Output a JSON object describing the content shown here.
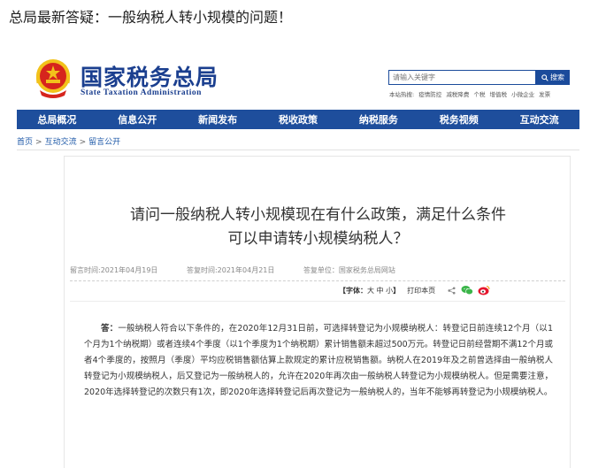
{
  "article": {
    "title": "总局最新答疑：一般纳税人转小规模的问题！"
  },
  "site": {
    "name_cn": "国家税务总局",
    "name_en": "State Taxation Administration"
  },
  "search": {
    "placeholder": "请输入关键字",
    "button_label": "搜索",
    "hot_label": "本站热搜:",
    "hot_terms": [
      "疫情防控",
      "减税降费",
      "个税",
      "增值税",
      "小微企业",
      "发票"
    ]
  },
  "nav": {
    "items": [
      "总局概况",
      "信息公开",
      "新闻发布",
      "税收政策",
      "纳税服务",
      "税务视频",
      "互动交流"
    ]
  },
  "breadcrumb": {
    "items": [
      "首页",
      "互动交流",
      "留言公开"
    ],
    "separator": ">"
  },
  "question": {
    "title_line1": "请问一般纳税人转小规模现在有什么政策，满足什么条件",
    "title_line2": "可以申请转小规模纳税人？",
    "posted": "留言时间:2021年04月19日",
    "answered": "答复时间:2021年04月21日",
    "department": "答复单位：国家税务总局网站"
  },
  "tools": {
    "font_label": "【字体：",
    "font_large": "大",
    "font_medium": "中",
    "font_small": "小",
    "font_close": "】",
    "print": "打印本页"
  },
  "answer": {
    "lead": "答：",
    "body": "一般纳税人符合以下条件的，在2020年12月31日前，可选择转登记为小规模纳税人：转登记日前连续12个月（以1个月为1个纳税期）或者连续4个季度（以1个季度为1个纳税期）累计销售额未超过500万元。转登记日前经营期不满12个月或者4个季度的，按照月（季度）平均应税销售额估算上款规定的累计应税销售额。纳税人在2019年及之前曾选择由一般纳税人转登记为小规模纳税人，后又登记为一般纳税人的，允许在2020年再次由一般纳税人转登记为小规模纳税人。但是需要注意，2020年选择转登记的次数只有1次，即2020年选择转登记后再次登记为一般纳税人的，当年不能够再转登记为小规模纳税人。"
  },
  "colors": {
    "brand_blue": "#1e4e9c",
    "link_blue": "#1f5aa8",
    "emblem_red": "#d6251d",
    "emblem_gold": "#f2c21b",
    "wechat_green": "#3bb54a",
    "weibo_red": "#e6162d"
  }
}
